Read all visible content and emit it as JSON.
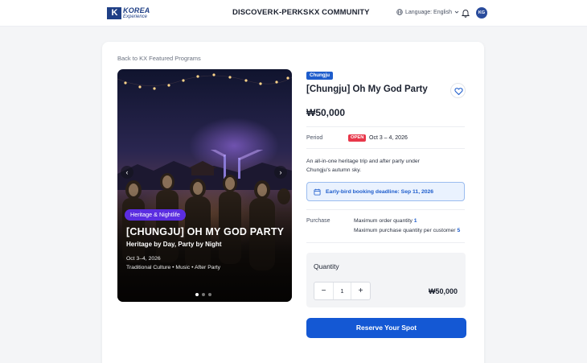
{
  "header": {
    "logo_mark": "K",
    "logo_line1": "KOREA",
    "logo_line2": "Experience",
    "nav": [
      "DISCOVER",
      "K-PERKS",
      "KX COMMUNITY"
    ],
    "language": "Language: English",
    "avatar_initials": "KG"
  },
  "breadcrumb": "Back to KX Featured Programs",
  "hero": {
    "tag": "Heritage & Nightlife",
    "title": "[CHUNGJU] OH MY GOD PARTY",
    "subtitle": "Heritage by Day, Party by Night",
    "date": "Oct 3–4, 2026",
    "meta": "Traditional Culture • Music • After Party",
    "prev": "‹",
    "next": "›"
  },
  "details": {
    "city": "Chungju",
    "title": "[Chungju] Oh My God Party",
    "price": "₩50,000",
    "period_label": "Period",
    "status": "OPEN",
    "period": "Oct 3 – 4, 2026",
    "description": "An all-in-one heritage trip and after party under Chungju's autumn sky.",
    "early_bird": "Early-bird booking deadline: Sep 11, 2026",
    "purchase_label": "Purchase",
    "max_order_label": "Maximum order quantity",
    "max_order_value": "1",
    "max_purchase_label": "Maximum purchase quantity per customer",
    "max_purchase_value": "5"
  },
  "quantity": {
    "label": "Quantity",
    "minus": "−",
    "value": "1",
    "plus": "+",
    "total": "₩50,000"
  },
  "cta": "Reserve Your Spot",
  "colors": {
    "accent": "#1458d4",
    "badge_blue": "#1e5dcc",
    "open_red": "#e8374a",
    "tag_purple": "#5b2de0"
  }
}
